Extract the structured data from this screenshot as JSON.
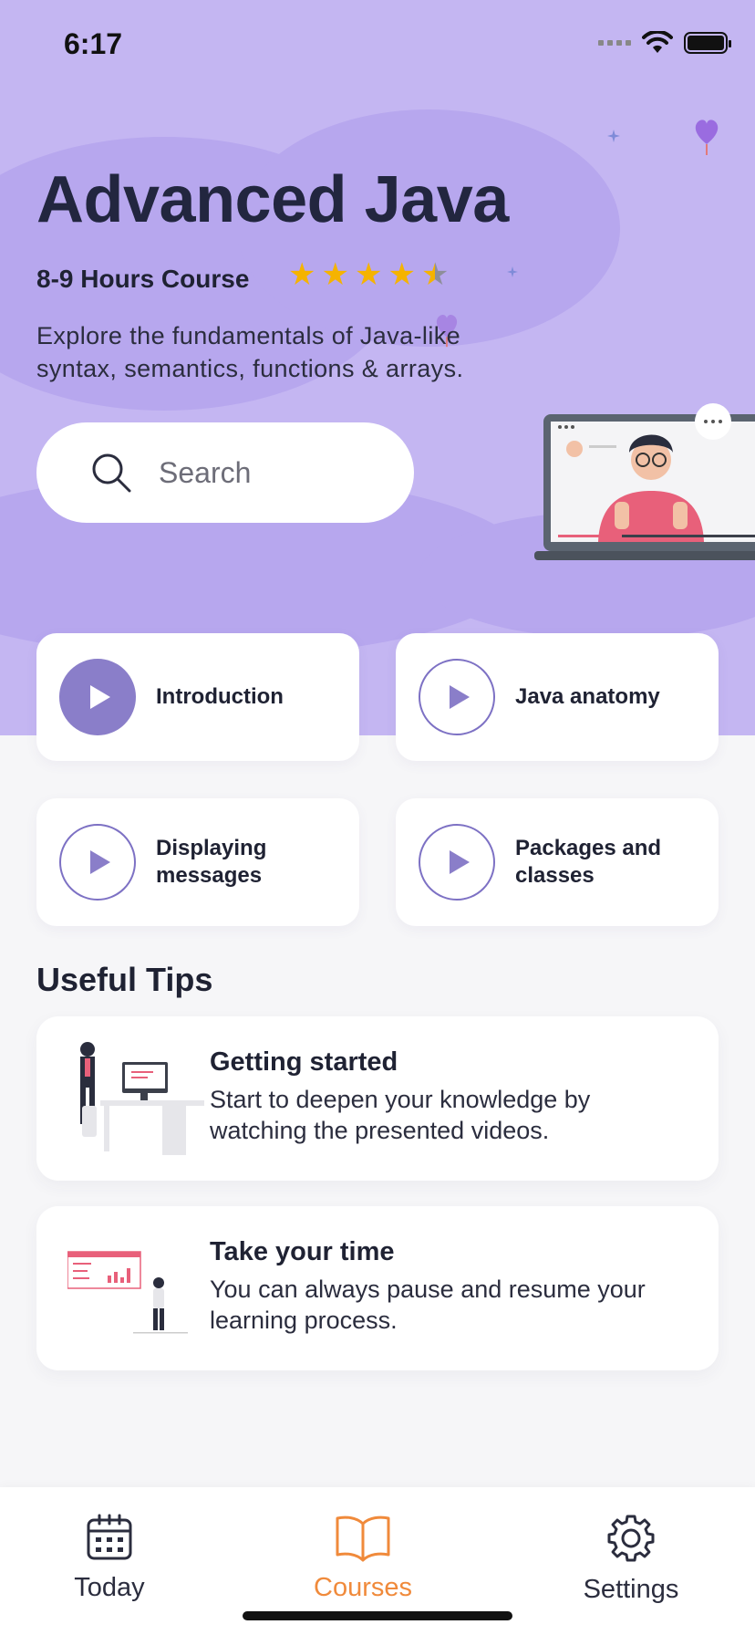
{
  "status_bar": {
    "time": "6:17"
  },
  "hero": {
    "title": "Advanced Java",
    "subtitle": "8-9 Hours Course",
    "rating": 4.5,
    "description": "Explore the fundamentals of Java-like syntax, semantics, functions & arrays."
  },
  "search": {
    "placeholder": "Search"
  },
  "lessons": [
    {
      "label": "Introduction",
      "active": true
    },
    {
      "label": "Java anatomy",
      "active": false
    },
    {
      "label": "Displaying messages",
      "active": false
    },
    {
      "label": "Packages and classes",
      "active": false
    }
  ],
  "useful_tips": {
    "title": "Useful Tips",
    "items": [
      {
        "title": "Getting started",
        "text": "Start to deepen your knowledge by watching the presented videos."
      },
      {
        "title": "Take your time",
        "text": "You can always pause and resume your learning process."
      }
    ]
  },
  "tabbar": {
    "items": [
      {
        "label": "Today",
        "icon": "calendar-icon"
      },
      {
        "label": "Courses",
        "icon": "book-icon",
        "active": true
      },
      {
        "label": "Settings",
        "icon": "gear-icon"
      }
    ]
  },
  "colors": {
    "accent": "#8a7ec9",
    "hero_bg": "#c4b6f2",
    "active_tab": "#f08a3b",
    "star": "#f5b300"
  }
}
